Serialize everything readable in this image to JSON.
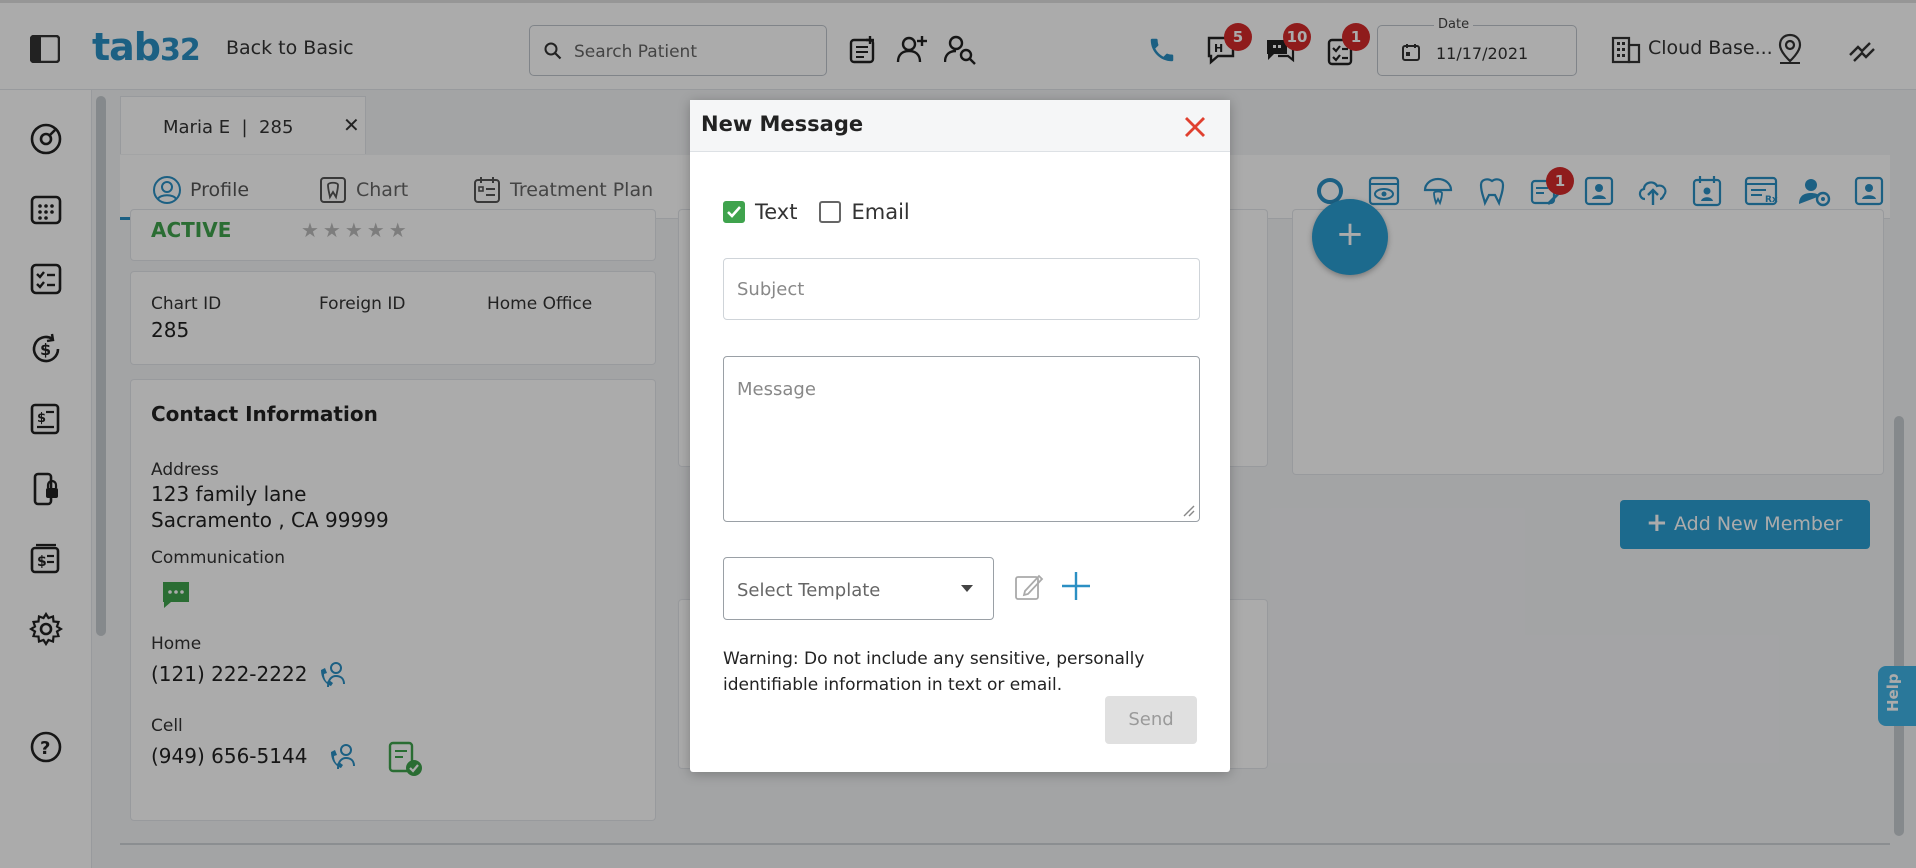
{
  "header": {
    "logo": "tab",
    "logo_num": "32",
    "back_to_basic": "Back to Basic",
    "search_placeholder": "Search Patient",
    "badges": {
      "hc": "5",
      "messages": "10",
      "tasks": "1"
    },
    "date_label": "Date",
    "date_value": "11/17/2021",
    "location": "Cloud Base..."
  },
  "patient_tab": {
    "name": "Maria E  |  285",
    "close": "✕"
  },
  "tabs": [
    {
      "label": "Profile"
    },
    {
      "label": "Chart"
    },
    {
      "label": "Treatment Plan"
    }
  ],
  "toolbar_badge": "1",
  "profile": {
    "status": "ACTIVE",
    "rating": "★★★★★",
    "chart_id_label": "Chart ID",
    "chart_id": "285",
    "foreign_id_label": "Foreign ID",
    "home_office_label": "Home Office",
    "contact_title": "Contact Information",
    "address_label": "Address",
    "address_line1": "123 family lane",
    "address_line2": "Sacramento , CA 99999",
    "communication_label": "Communication",
    "home_label": "Home",
    "home_phone": "(121) 222-2222",
    "cell_label": "Cell",
    "cell_phone": "(949) 656-5144"
  },
  "add_member": {
    "plus": "+",
    "label": "Add New Member"
  },
  "fab_plus": "+",
  "help": "Help",
  "modal": {
    "title": "New Message",
    "text_label": "Text",
    "email_label": "Email",
    "subject_placeholder": "Subject",
    "message_placeholder": "Message",
    "template_placeholder": "Select Template",
    "warning": "Warning: Do not include any sensitive, personally identifiable information in text or email.",
    "send": "Send"
  },
  "colors": {
    "brand": "#2b8fc3",
    "checkbox": "#3fa34d",
    "badge": "#d62b2b",
    "close": "#e0402f",
    "add_button": "#2b9fd3"
  }
}
